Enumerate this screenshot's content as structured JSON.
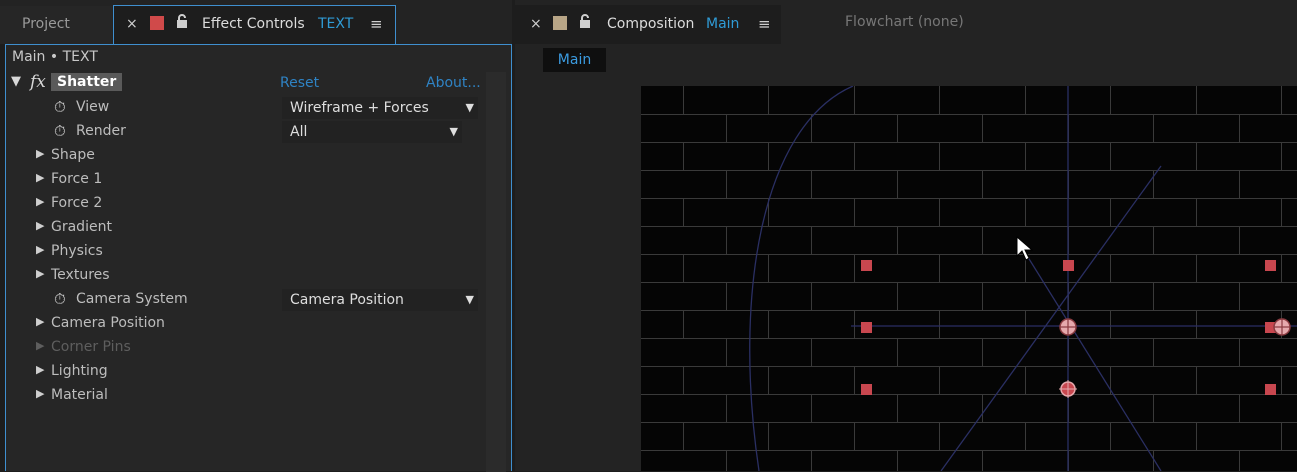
{
  "left_tabs": {
    "project_label": "Project",
    "effect_controls_label": "Effect Controls",
    "effect_controls_layer": "TEXT"
  },
  "effect_controls": {
    "breadcrumb": "Main • TEXT",
    "effect": {
      "name": "Shatter",
      "reset_label": "Reset",
      "about_label": "About..."
    },
    "properties": [
      {
        "label": "View",
        "kind": "dropdown",
        "value": "Wireframe + Forces"
      },
      {
        "label": "Render",
        "kind": "dropdown",
        "value": "All"
      },
      {
        "label": "Shape",
        "kind": "group"
      },
      {
        "label": "Force 1",
        "kind": "group"
      },
      {
        "label": "Force 2",
        "kind": "group"
      },
      {
        "label": "Gradient",
        "kind": "group"
      },
      {
        "label": "Physics",
        "kind": "group"
      },
      {
        "label": "Textures",
        "kind": "group"
      },
      {
        "label": "Camera System",
        "kind": "dropdown",
        "value": "Camera Position"
      },
      {
        "label": "Camera Position",
        "kind": "group"
      },
      {
        "label": "Corner Pins",
        "kind": "group",
        "disabled": true
      },
      {
        "label": "Lighting",
        "kind": "group"
      },
      {
        "label": "Material",
        "kind": "group"
      }
    ]
  },
  "right_tabs": {
    "composition_label": "Composition",
    "composition_name": "Main",
    "flowchart_label": "Flowchart",
    "flowchart_value": "(none)"
  },
  "composition": {
    "nav_tab": "Main"
  },
  "colors": {
    "accent_blue": "#2f9bd6",
    "panel_border": "#3f8fcf",
    "effect_label_color": "#d04a4a",
    "comp_label_color": "#b8a586",
    "force_marker": "#c8474f"
  },
  "icons": [
    "close-icon",
    "label-color-swatch",
    "lock-icon",
    "panel-menu-icon",
    "fx-icon",
    "stopwatch-icon",
    "twirl-triangle-icon",
    "dropdown-arrow-icon",
    "mouse-cursor-icon"
  ]
}
